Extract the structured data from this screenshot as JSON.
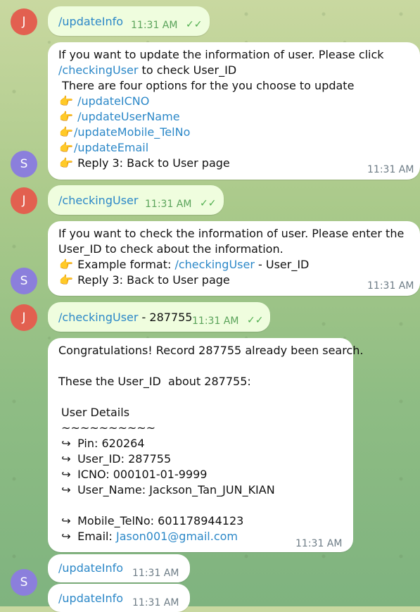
{
  "senders": {
    "j": "J",
    "s": "S"
  },
  "messages": [
    {
      "text": "/updateInfo",
      "time": "11:31 AM"
    },
    {
      "lines": [
        "If you want to update the information of user. Please click",
        "to check User_ID",
        " There are four options for the you choose to update",
        "Reply 3: Back to User page"
      ],
      "links": [
        "/checkingUser",
        "/updateICNO",
        "/updateUserName",
        "/updateMobile_TelNo",
        "/updateEmail"
      ],
      "time": "11:31 AM"
    },
    {
      "text": "/checkingUser",
      "time": "11:31 AM"
    },
    {
      "lines": [
        "If you want to check the information of user. Please enter the",
        "User_ID to check about the information.",
        "Example format:",
        " - User_ID",
        "Reply 3: Back to User page"
      ],
      "links": [
        "/checkingUser"
      ],
      "time": "11:31 AM"
    },
    {
      "text": "/checkingUser",
      "suffix": " - 287755",
      "time": "11:31 AM"
    },
    {
      "lines": [
        "Congratulations! Record 287755 already been search.",
        "These the User_ID  about 287755:",
        "User Details",
        "~~~~~~~~~~",
        "Pin: 620264",
        "User_ID: 287755",
        "ICNO: 000101-01-9999",
        "User_Name: Jackson_Tan_JUN_KIAN",
        "Mobile_TelNo: 601178944123",
        "Email: "
      ],
      "email": "Jason001@gmail.com",
      "time": "11:31 AM"
    },
    {
      "text": "/updateInfo",
      "time": "11:31 AM"
    },
    {
      "text": "/updateInfo",
      "time": "11:31 AM"
    }
  ],
  "icons": {
    "point": "👉",
    "arrow": "↪",
    "check": "✓✓"
  }
}
